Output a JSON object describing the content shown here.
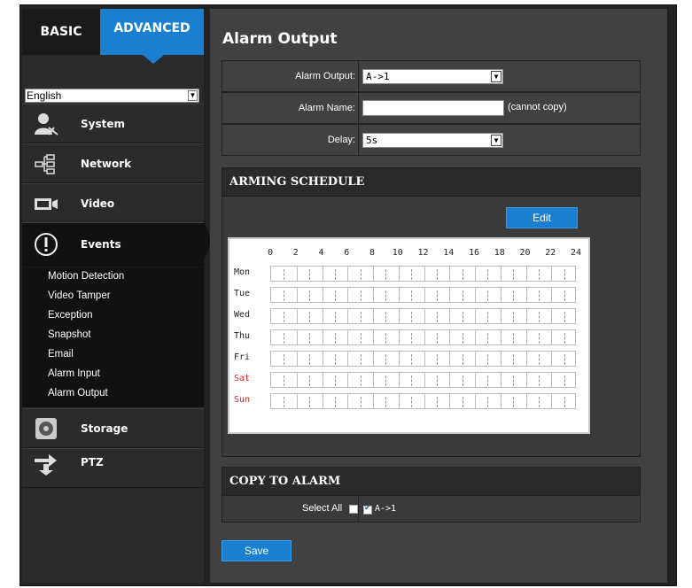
{
  "sidebar": {
    "tabs": {
      "basic": "BASIC",
      "advanced": "ADVANCED"
    },
    "language": "English",
    "items": [
      {
        "label": "System",
        "icon": "system-user-icon"
      },
      {
        "label": "Network",
        "icon": "network-icon"
      },
      {
        "label": "Video",
        "icon": "video-camera-icon"
      },
      {
        "label": "Events",
        "icon": "events-alert-icon"
      },
      {
        "label": "Storage",
        "icon": "storage-disk-icon"
      },
      {
        "label": "PTZ",
        "icon": "ptz-arrows-icon"
      }
    ],
    "sub_items": [
      "Motion Detection",
      "Video Tamper",
      "Exception",
      "Snapshot",
      "Email",
      "Alarm Input",
      "Alarm Output"
    ]
  },
  "main": {
    "title": "Alarm Output",
    "form": {
      "alarm_output_label": "Alarm Output:",
      "alarm_output_value": "A->1",
      "alarm_name_label": "Alarm Name:",
      "alarm_name_value": "",
      "cannot_copy": "(cannot copy)",
      "delay_label": "Delay:",
      "delay_value": "5s"
    },
    "arming_schedule": {
      "header": "ARMING SCHEDULE",
      "edit_button": "Edit",
      "hours": [
        "0",
        "2",
        "4",
        "6",
        "8",
        "10",
        "12",
        "14",
        "16",
        "18",
        "20",
        "22",
        "24"
      ],
      "days": [
        "Mon",
        "Tue",
        "Wed",
        "Thu",
        "Fri",
        "Sat",
        "Sun"
      ],
      "weekend_color": "#e02020"
    },
    "copy_to_alarm": {
      "header": "COPY TO ALARM",
      "select_all_label": "Select All",
      "select_all_checked": false,
      "option_label": "A->1",
      "option_checked": true
    },
    "save_button": "Save"
  },
  "colors": {
    "accent": "#1b7fd1",
    "panel": "#414141",
    "sidebar": "#2b2b2b"
  }
}
